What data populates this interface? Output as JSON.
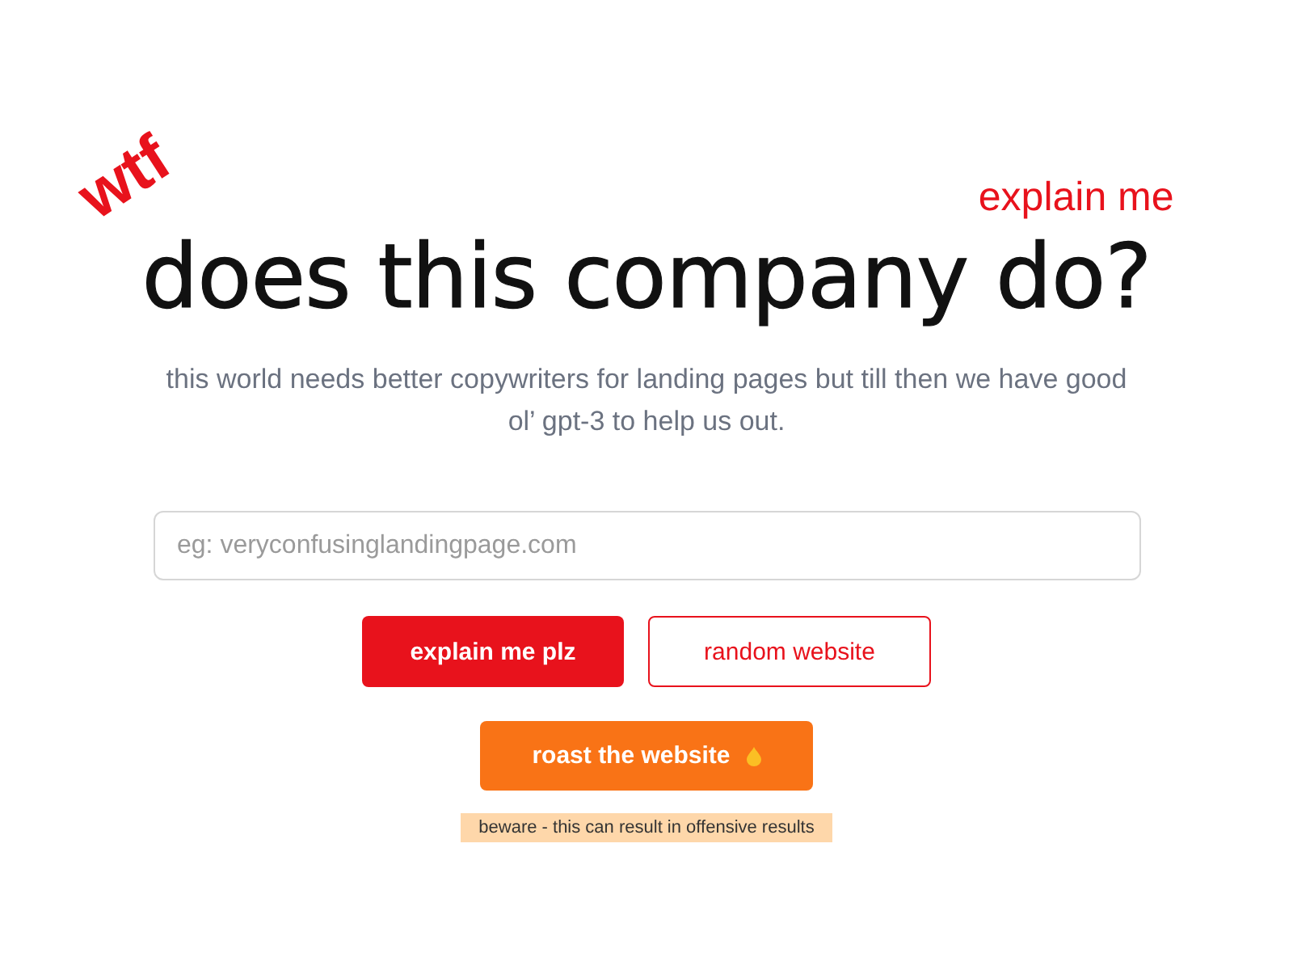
{
  "heading": {
    "sticker": "wtf",
    "tagline": "explain me",
    "title": "does this company do?"
  },
  "subtitle": "this world needs better copywriters for landing pages but till then we have good ol’ gpt-3 to help us out.",
  "search": {
    "placeholder": "eg: veryconfusinglandingpage.com"
  },
  "buttons": [
    {
      "label": "explain me plz",
      "kind": "primary"
    },
    {
      "label": "random website",
      "kind": "outline"
    }
  ],
  "roast": {
    "label": "roast the website"
  },
  "warning": "beware - this can result in offensive results"
}
